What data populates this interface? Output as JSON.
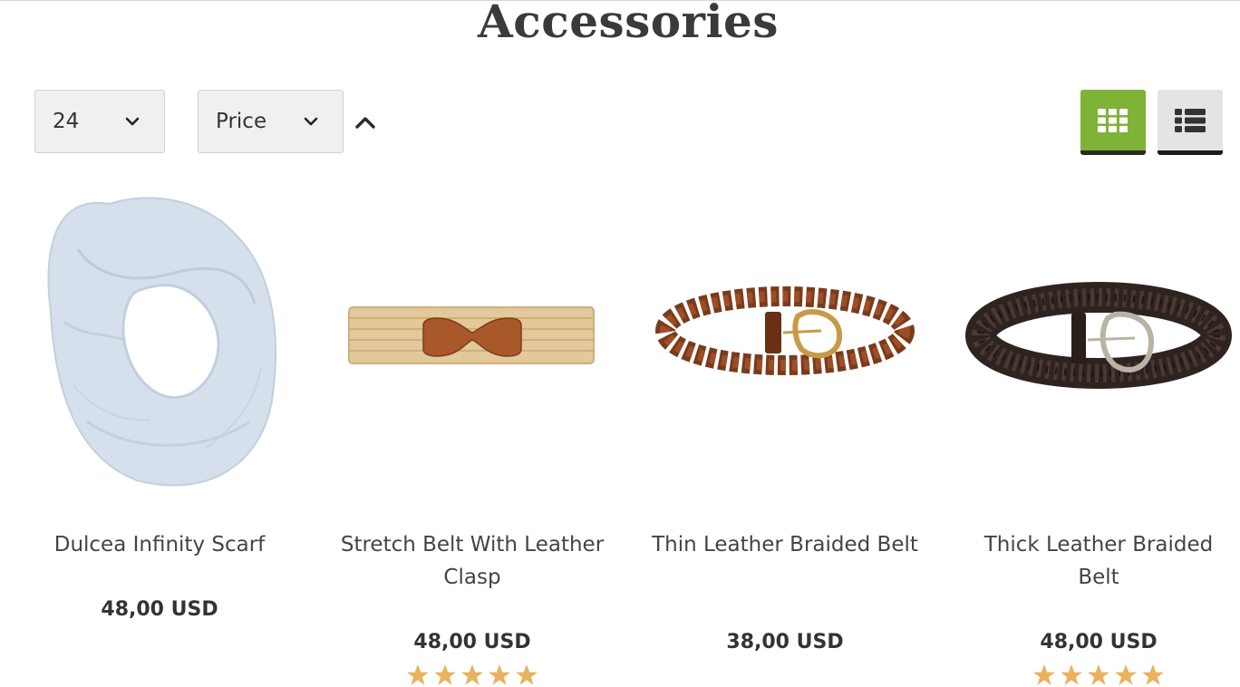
{
  "page": {
    "title": "Accessories"
  },
  "toolbar": {
    "per_page": {
      "value": "24"
    },
    "sort_by": {
      "value": "Price"
    },
    "sort_direction": "ascending",
    "view": {
      "active": "grid"
    }
  },
  "colors": {
    "accent": "#7fb337",
    "star": "#e8b25e",
    "text": "#3b3b3b"
  },
  "products": [
    {
      "name": "Dulcea Infinity Scarf",
      "price": "48,00 USD",
      "rating": null
    },
    {
      "name": "Stretch Belt With Leather Clasp",
      "price": "48,00 USD",
      "rating": 5
    },
    {
      "name": "Thin Leather Braided Belt",
      "price": "38,00 USD",
      "rating": null
    },
    {
      "name": "Thick Leather Braided Belt",
      "price": "48,00 USD",
      "rating": 5
    }
  ]
}
